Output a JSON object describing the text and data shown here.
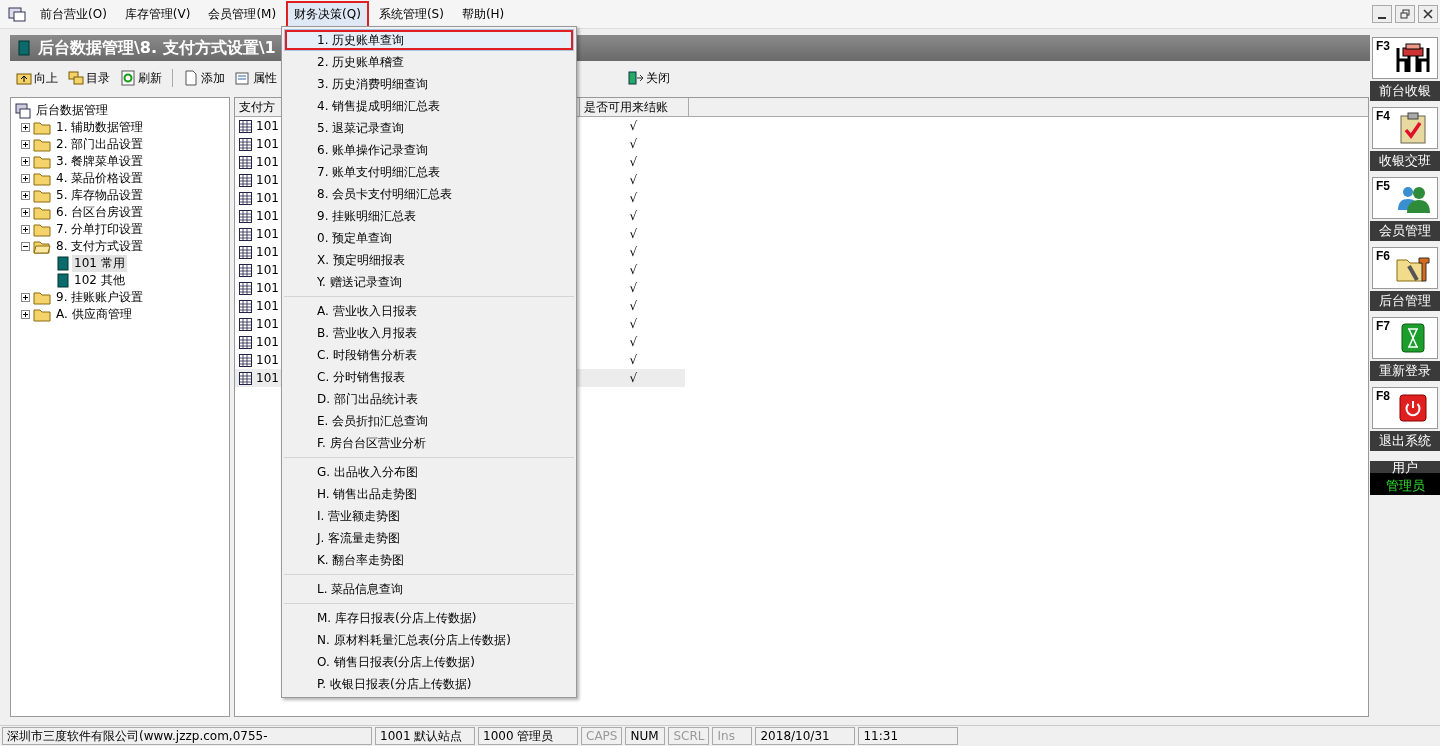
{
  "menubar": [
    {
      "label": "前台营业(O)",
      "selected": false
    },
    {
      "label": "库存管理(V)",
      "selected": false
    },
    {
      "label": "会员管理(M)",
      "selected": false
    },
    {
      "label": "财务决策(Q)",
      "selected": true
    },
    {
      "label": "系统管理(S)",
      "selected": false
    },
    {
      "label": "帮助(H)",
      "selected": false
    }
  ],
  "title": "后台数据管理\\8. 支付方式设置\\1",
  "toolbar": [
    {
      "label": "向上",
      "kind": "up"
    },
    {
      "label": "目录",
      "kind": "folders"
    },
    {
      "label": "刷新",
      "kind": "refresh"
    },
    {
      "label": "添加",
      "kind": "page"
    },
    {
      "label": "属性",
      "kind": "props"
    },
    {
      "label": "关闭",
      "kind": "exit"
    }
  ],
  "tree": {
    "label": "后台数据管理",
    "children": [
      {
        "label": "1. 辅助数据管理",
        "expanded": false,
        "selected": false
      },
      {
        "label": "2. 部门出品设置",
        "expanded": false,
        "selected": false
      },
      {
        "label": "3. 餐牌菜单设置",
        "expanded": false,
        "selected": false
      },
      {
        "label": "4. 菜品价格设置",
        "expanded": false,
        "selected": false
      },
      {
        "label": "5. 库存物品设置",
        "expanded": false,
        "selected": false
      },
      {
        "label": "6. 台区台房设置",
        "expanded": false,
        "selected": false
      },
      {
        "label": "7. 分单打印设置",
        "expanded": false,
        "selected": false
      },
      {
        "label": "8. 支付方式设置",
        "expanded": true,
        "selected": false,
        "children": [
          {
            "label": "101 常用",
            "selected": true
          },
          {
            "label": "102 其他",
            "selected": false
          }
        ]
      },
      {
        "label": "9. 挂账账户设置",
        "expanded": false,
        "selected": false
      },
      {
        "label": "A. 供应商管理",
        "expanded": false,
        "selected": false
      }
    ]
  },
  "table": {
    "columns": [
      "支付方",
      "是否可用来结账"
    ],
    "rows": [
      {
        "code": "101",
        "check": "√",
        "selected": false
      },
      {
        "code": "101",
        "check": "√",
        "selected": false
      },
      {
        "code": "101",
        "check": "√",
        "selected": false
      },
      {
        "code": "101",
        "check": "√",
        "selected": false
      },
      {
        "code": "101",
        "check": "√",
        "selected": false
      },
      {
        "code": "101",
        "check": "√",
        "selected": false
      },
      {
        "code": "101",
        "check": "√",
        "selected": false
      },
      {
        "code": "101",
        "check": "√",
        "selected": false
      },
      {
        "code": "101",
        "check": "√",
        "selected": false
      },
      {
        "code": "101",
        "check": "√",
        "selected": false
      },
      {
        "code": "101",
        "check": "√",
        "selected": false
      },
      {
        "code": "101",
        "check": "√",
        "selected": false
      },
      {
        "code": "101",
        "check": "√",
        "selected": false
      },
      {
        "code": "101",
        "check": "√",
        "selected": false
      },
      {
        "code": "101",
        "check": "√",
        "selected": true
      }
    ]
  },
  "menu": [
    [
      {
        "label": "1. 历史账单查询",
        "selected": true
      },
      {
        "label": "2. 历史账单稽查",
        "selected": false
      },
      {
        "label": "3. 历史消费明细查询",
        "selected": false
      },
      {
        "label": "4. 销售提成明细汇总表",
        "selected": false
      },
      {
        "label": "5. 退菜记录查询",
        "selected": false
      },
      {
        "label": "6. 账单操作记录查询",
        "selected": false
      },
      {
        "label": "7. 账单支付明细汇总表",
        "selected": false
      },
      {
        "label": "8. 会员卡支付明细汇总表",
        "selected": false
      },
      {
        "label": "9. 挂账明细汇总表",
        "selected": false
      },
      {
        "label": "0. 预定单查询",
        "selected": false
      },
      {
        "label": "X. 预定明细报表",
        "selected": false
      },
      {
        "label": "Y. 赠送记录查询",
        "selected": false
      }
    ],
    [
      {
        "label": "A. 营业收入日报表",
        "selected": false
      },
      {
        "label": "B. 营业收入月报表",
        "selected": false
      },
      {
        "label": "C. 时段销售分析表",
        "selected": false
      },
      {
        "label": "C. 分时销售报表",
        "selected": false
      },
      {
        "label": "D. 部门出品统计表",
        "selected": false
      },
      {
        "label": "E. 会员折扣汇总查询",
        "selected": false
      },
      {
        "label": "F. 房台台区营业分析",
        "selected": false
      }
    ],
    [
      {
        "label": "G. 出品收入分布图",
        "selected": false
      },
      {
        "label": "H. 销售出品走势图",
        "selected": false
      },
      {
        "label": "I. 营业额走势图",
        "selected": false
      },
      {
        "label": "J. 客流量走势图",
        "selected": false
      },
      {
        "label": "K. 翻台率走势图",
        "selected": false
      }
    ],
    [
      {
        "label": "L. 菜品信息查询",
        "selected": false
      }
    ],
    [
      {
        "label": "M. 库存日报表(分店上传数据)",
        "selected": false
      },
      {
        "label": "N. 原材料耗量汇总表(分店上传数据)",
        "selected": false
      },
      {
        "label": "O. 销售日报表(分店上传数据)",
        "selected": false
      },
      {
        "label": "P. 收银日报表(分店上传数据)",
        "selected": false
      }
    ]
  ],
  "side_buttons": [
    {
      "key": "F3",
      "label": "前台收银",
      "kind": "table"
    },
    {
      "key": "F4",
      "label": "收银交班",
      "kind": "clipboard"
    },
    {
      "key": "F5",
      "label": "会员管理",
      "kind": "people"
    },
    {
      "key": "F6",
      "label": "后台管理",
      "kind": "tools"
    },
    {
      "key": "F7",
      "label": "重新登录",
      "kind": "hourglass"
    },
    {
      "key": "F8",
      "label": "退出系统",
      "kind": "power"
    }
  ],
  "user": {
    "label": "用户",
    "value": "管理员"
  },
  "status_bar": {
    "info": [
      "深圳市三度软件有限公司(www.jzzp.com,0755-",
      "1001 默认站点",
      "1000 管理员"
    ],
    "keys": [
      {
        "text": "CAPS",
        "on": false
      },
      {
        "text": "NUM",
        "on": true
      },
      {
        "text": "SCRL",
        "on": false
      },
      {
        "text": "Ins",
        "on": false
      }
    ],
    "date": "2018/10/31",
    "time": "11:31"
  }
}
